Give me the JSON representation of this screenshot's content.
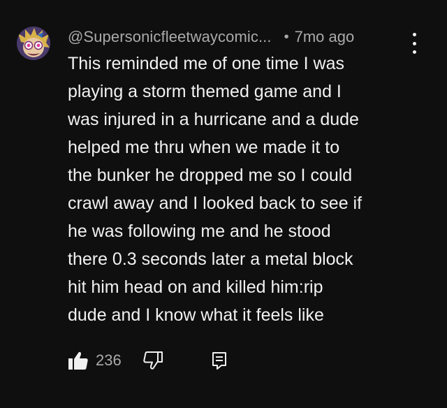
{
  "comment": {
    "author": "@Supersonicfleetwaycomic...",
    "separator": "•",
    "timestamp": "7mo ago",
    "text_lines": [
      "This reminded me of one time I was",
      "playing a storm themed game and I",
      "was injured in a hurricane and a dude",
      "helped me thru when we made it to",
      "the bunker he dropped me so I could",
      "crawl away and I looked back to see if",
      "he was following me and he stood",
      "there 0.3 seconds later a metal block",
      "hit him head on and killed him:rip",
      "dude and I know what it feels like"
    ],
    "like_count": "236",
    "icons": {
      "avatar": "avatar-image",
      "menu": "more-vert-icon",
      "like": "thumbs-up-icon",
      "dislike": "thumbs-down-icon",
      "reply": "reply-comment-icon"
    },
    "colors": {
      "background": "#0f0f0f",
      "text": "#f1f1f1",
      "secondary_text": "#aaaaaa"
    }
  }
}
